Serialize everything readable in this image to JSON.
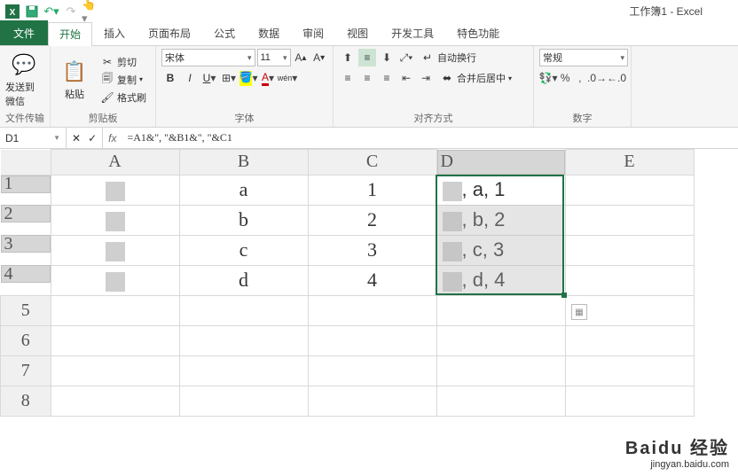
{
  "title": "工作簿1 - Excel",
  "tabs": {
    "file": "文件",
    "home": "开始",
    "insert": "插入",
    "layout": "页面布局",
    "formula": "公式",
    "data": "数据",
    "review": "审阅",
    "view": "视图",
    "dev": "开发工具",
    "feat": "特色功能"
  },
  "ribbon": {
    "wechat": "发送到微信",
    "wechat_grp": "文件传输",
    "paste": "粘贴",
    "cut": "剪切",
    "copy": "复制",
    "format": "格式刷",
    "clip_grp": "剪贴板",
    "font_name": "宋体",
    "font_size": "11",
    "font_grp": "字体",
    "wrap": "自动换行",
    "merge": "合并后居中",
    "align_grp": "对齐方式",
    "num_fmt": "常规",
    "num_grp": "数字"
  },
  "namebox": "D1",
  "formula": "=A1&\", \"&B1&\", \"&C1",
  "cols": [
    "A",
    "B",
    "C",
    "D",
    "E"
  ],
  "rows": [
    "1",
    "2",
    "3",
    "4",
    "5",
    "6",
    "7",
    "8"
  ],
  "cells": {
    "B1": "a",
    "B2": "b",
    "B3": "c",
    "B4": "d",
    "C1": "1",
    "C2": "2",
    "C3": "3",
    "C4": "4",
    "D1": ", a, 1",
    "D2": ", b, 2",
    "D3": ", c, 3",
    "D4": ", d, 4"
  },
  "watermark": {
    "brand": "Baidu 经验",
    "url": "jingyan.baidu.com"
  }
}
